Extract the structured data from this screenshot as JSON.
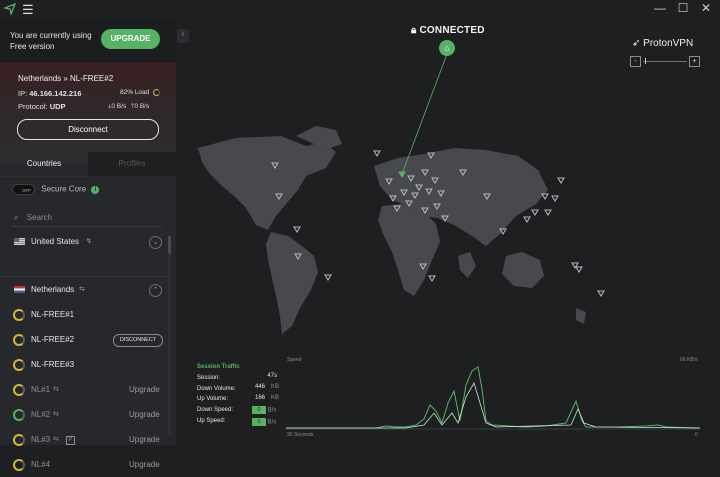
{
  "window": {
    "minimize": "—",
    "maximize": "☐",
    "close": "✕",
    "menu_icon": "hamburger-icon"
  },
  "promo": {
    "text": "You are currently using Free version",
    "upgrade": "UPGRADE"
  },
  "connection": {
    "server": "Netherlands » NL-FREE#2",
    "ip_label": "IP:",
    "ip": "46.166.142.216",
    "load": "82% Load",
    "protocol_label": "Protocol:",
    "protocol": "UDP",
    "down": "0 B/s",
    "up": "0 B/s",
    "disconnect": "Disconnect"
  },
  "tabs": {
    "countries": "Countries",
    "profiles": "Profiles"
  },
  "secure_core": {
    "toggle": "OFF",
    "label": "Secure Core"
  },
  "search": {
    "placeholder": "Search"
  },
  "countries": [
    {
      "name": "United States",
      "flag": "us"
    },
    {
      "name": "Netherlands",
      "flag": "nl"
    }
  ],
  "servers": [
    {
      "name": "NL-FREE#1"
    },
    {
      "name": "NL-FREE#2",
      "action": "DISCONNECT"
    },
    {
      "name": "NL-FREE#3"
    },
    {
      "name": "NL#1",
      "action": "Upgrade"
    },
    {
      "name": "NL#2",
      "action": "Upgrade"
    },
    {
      "name": "NL#3",
      "action": "Upgrade"
    },
    {
      "name": "NL#4",
      "action": "Upgrade"
    }
  ],
  "map": {
    "status": "CONNECTED",
    "brand": "ProtonVPN",
    "zoom_out": "-",
    "zoom_in": "+"
  },
  "traffic": {
    "title": "Session Traffic",
    "session_label": "Session:",
    "session": "47s",
    "down_volume_label": "Down Volume:",
    "down_volume": "446",
    "down_volume_unit": "KB",
    "up_volume_label": "Up Volume:",
    "up_volume": "166",
    "up_volume_unit": "KB",
    "down_speed_label": "Down Speed:",
    "down_speed": "0",
    "down_speed_unit": "B/s",
    "up_speed_label": "Up Speed:",
    "up_speed": "0",
    "up_speed_unit": "B/s"
  },
  "graph": {
    "speed_label": "Speed",
    "max_label": "66  KB/s",
    "time_label": "30 Seconds",
    "zero_label": "0"
  },
  "colors": {
    "accent": "#56b366",
    "bg": "#1e1f21",
    "sidebar": "#26282b"
  }
}
